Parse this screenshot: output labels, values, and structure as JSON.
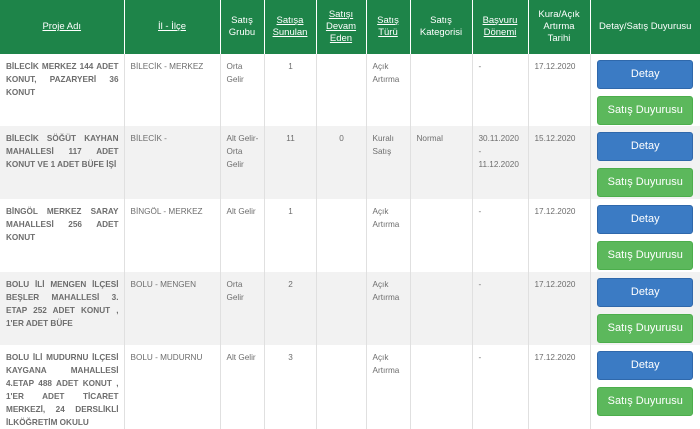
{
  "headers": {
    "project": "Proje Adı",
    "location": "İl - İlçe",
    "sale_group": "Satış Grubu",
    "offered": "Satışa Sunulan",
    "ongoing": "Satışı Devam Eden",
    "sale_type": "Satış Türü",
    "sale_category": "Satış Kategorisi",
    "application_period": "Başvuru Dönemi",
    "draw_date": "Kura/Açık Artırma Tarihi",
    "detail_announcement": "Detay/Satış Duyurusu"
  },
  "buttons": {
    "detail": "Detay",
    "announcement": "Satış Duyurusu"
  },
  "rows": [
    {
      "project": "BİLECİK MERKEZ 144 ADET KONUT, PAZARYERİ 36 KONUT",
      "location": "BİLECİK - MERKEZ",
      "sale_group": "Orta Gelir",
      "offered": "1",
      "ongoing": "",
      "sale_type": "Açık Artırma",
      "sale_category": "",
      "application_period": "-",
      "draw_date": "17.12.2020"
    },
    {
      "project": "BİLECİK SÖĞÜT KAYHAN MAHALLESİ 117 ADET KONUT VE 1 ADET BÜFE İŞİ",
      "location": "BİLECİK -",
      "sale_group": "Alt Gelir-Orta Gelir",
      "offered": "11",
      "ongoing": "0",
      "sale_type": "Kuralı Satış",
      "sale_category": "Normal",
      "application_period": "30.11.2020 - 11.12.2020",
      "draw_date": "15.12.2020"
    },
    {
      "project": "BİNGÖL MERKEZ SARAY MAHALLESİ 256 ADET KONUT",
      "location": "BİNGÖL - MERKEZ",
      "sale_group": "Alt Gelir",
      "offered": "1",
      "ongoing": "",
      "sale_type": "Açık Artırma",
      "sale_category": "",
      "application_period": "-",
      "draw_date": "17.12.2020"
    },
    {
      "project": "BOLU İLİ MENGEN İLÇESİ BEŞLER MAHALLESİ 3. ETAP 252 ADET KONUT , 1'ER ADET BÜFE",
      "location": "BOLU - MENGEN",
      "sale_group": "Orta Gelir",
      "offered": "2",
      "ongoing": "",
      "sale_type": "Açık Artırma",
      "sale_category": "",
      "application_period": "-",
      "draw_date": "17.12.2020"
    },
    {
      "project": "BOLU İLİ MUDURNU İLÇESİ KAYGANA MAHALLESİ 4.ETAP 488 ADET KONUT , 1'ER ADET TİCARET MERKEZİ, 24 DERSLİKLİ İLKÖĞRETİM OKULU",
      "location": "BOLU - MUDURNU",
      "sale_group": "Alt Gelir",
      "offered": "3",
      "ongoing": "",
      "sale_type": "Açık Artırma",
      "sale_category": "",
      "application_period": "-",
      "draw_date": "17.12.2020"
    }
  ],
  "colors": {
    "header_bg": "#1e8449",
    "detail_button": "#3b7bc4",
    "announcement_button": "#5cb85c",
    "project_text": "#1e6b3e"
  }
}
